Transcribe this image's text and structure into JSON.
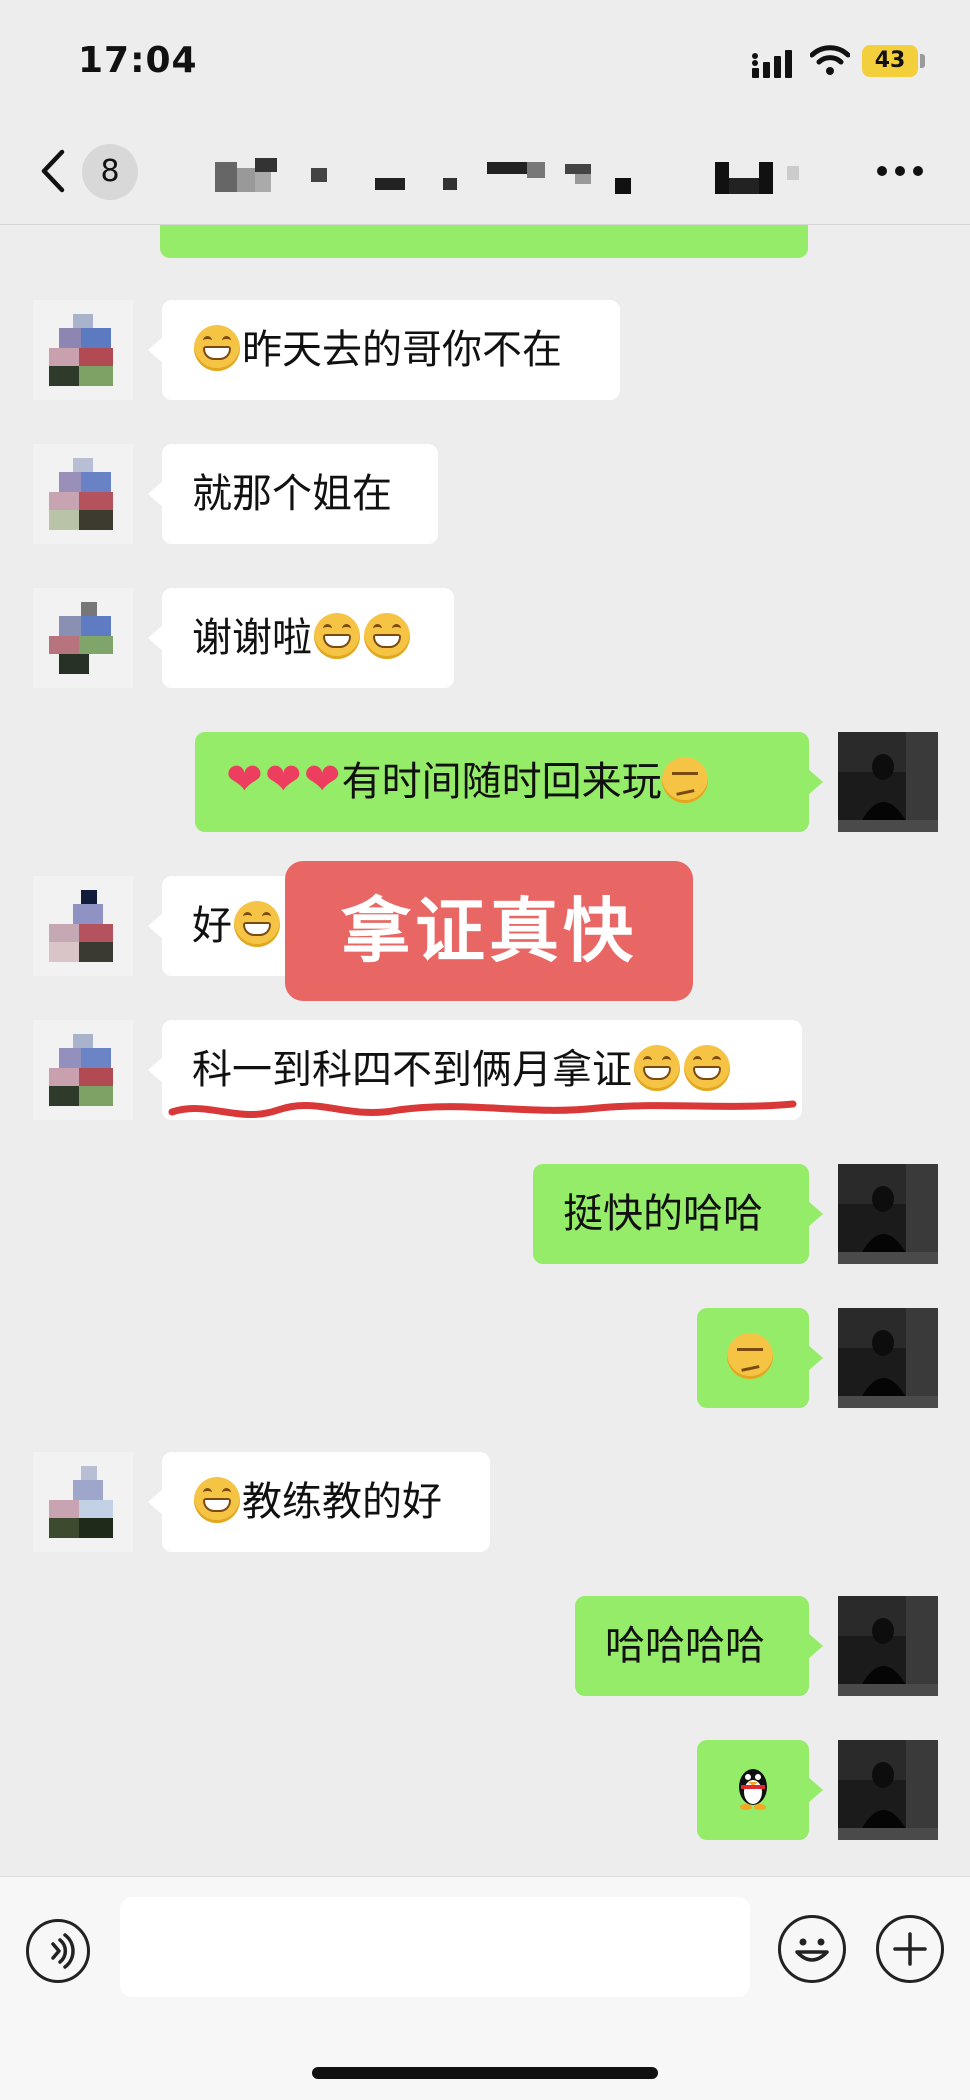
{
  "status_bar": {
    "time": "17:04",
    "battery": "43"
  },
  "nav": {
    "unread_count": "8"
  },
  "messages": [
    {
      "side": "in",
      "text": "昨天去的哥你不在"
    },
    {
      "side": "in",
      "text": "就那个姐在"
    },
    {
      "side": "in",
      "text": "谢谢啦"
    },
    {
      "side": "out",
      "text": "有时间随时回来玩"
    },
    {
      "side": "in",
      "text": "好"
    },
    {
      "side": "in",
      "text": "科一到科四不到俩月拿证"
    },
    {
      "side": "out",
      "text": "挺快的哈哈"
    },
    {
      "side": "out",
      "text": ""
    },
    {
      "side": "in",
      "text": "教练教的好"
    },
    {
      "side": "out",
      "text": "哈哈哈哈"
    },
    {
      "side": "out",
      "text": ""
    }
  ],
  "overlay": {
    "caption": "拿证真快"
  },
  "colors": {
    "background": "#ededed",
    "outgoing_bubble": "#95ec69",
    "incoming_bubble": "#ffffff",
    "overlay": "#e86664",
    "battery": "#f4cf3c"
  },
  "icons": [
    "chevron-left-icon",
    "more-icon",
    "voice-icon",
    "emoji-icon",
    "plus-icon",
    "wifi-icon",
    "signal-icon"
  ]
}
